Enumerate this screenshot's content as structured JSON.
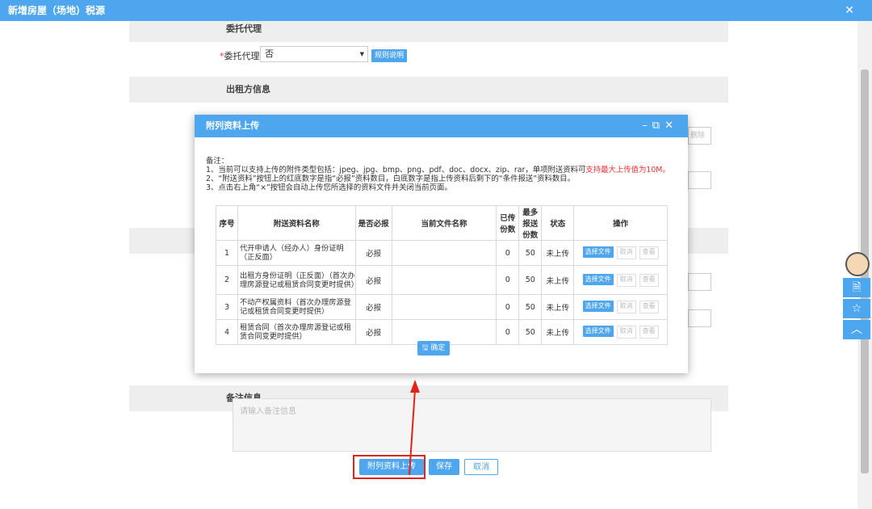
{
  "window": {
    "title": "新增房屋（场地）税源",
    "close_icon": "close-icon"
  },
  "background": {
    "sections": {
      "agent": "委托代理",
      "lessor": "出租方信息",
      "remark": "备注信息"
    },
    "agent_field": {
      "label": "委托代理:",
      "required_mark": "*",
      "value": "否",
      "rule_link": "规则说明"
    },
    "side_button_partial": "删除",
    "remark_placeholder": "请输入备注信息",
    "buttons": {
      "upload": "附列资料上传",
      "save": "保存",
      "cancel": "取消"
    }
  },
  "dialog": {
    "title": "附列资料上传",
    "notes": {
      "heading": "备注：",
      "line1_prefix": "1、当前可以支持上传的附件类型包括：jpeg、jpg、bmp、png、pdf、doc、docx、zip、rar，单项附送资料可",
      "line1_red": "支持最大上传值为10M。",
      "line2": "2、“附送资料”按钮上的红底数字是指“必报”资料数目，白底数字是指上传资料后剩下的“条件报送”资料数目。",
      "line3": "3、点击右上角“×”按钮会自动上传您所选择的资料文件并关闭当前页面。"
    },
    "table": {
      "headers": [
        "序号",
        "附送资料名称",
        "是否必报",
        "当前文件名称",
        "已传份数",
        "最多报送份数",
        "状态",
        "操作"
      ],
      "rows": [
        {
          "no": "1",
          "name": "代开申请人（经办人）身份证明（正反面）",
          "required": "必报",
          "file": "",
          "uploaded": "0",
          "max": "50",
          "status": "未上传"
        },
        {
          "no": "2",
          "name": "出租方身份证明（正反面）（首次办理房源登记或租赁合同变更时提供）",
          "required": "必报",
          "file": "",
          "uploaded": "0",
          "max": "50",
          "status": "未上传"
        },
        {
          "no": "3",
          "name": "不动产权属资料（首次办理房源登记或租赁合同变更时提供）",
          "required": "必报",
          "file": "",
          "uploaded": "0",
          "max": "50",
          "status": "未上传"
        },
        {
          "no": "4",
          "name": "租赁合同（首次办理房源登记或租赁合同变更时提供）",
          "required": "必报",
          "file": "",
          "uploaded": "0",
          "max": "50",
          "status": "未上传"
        }
      ],
      "ops": {
        "select": "选择文件",
        "cancel": "取消",
        "view": "查看"
      }
    },
    "confirm": "确定"
  },
  "colors": {
    "accent": "#4ea6ef",
    "warning": "#e33",
    "highlight_box": "#e2231a"
  }
}
